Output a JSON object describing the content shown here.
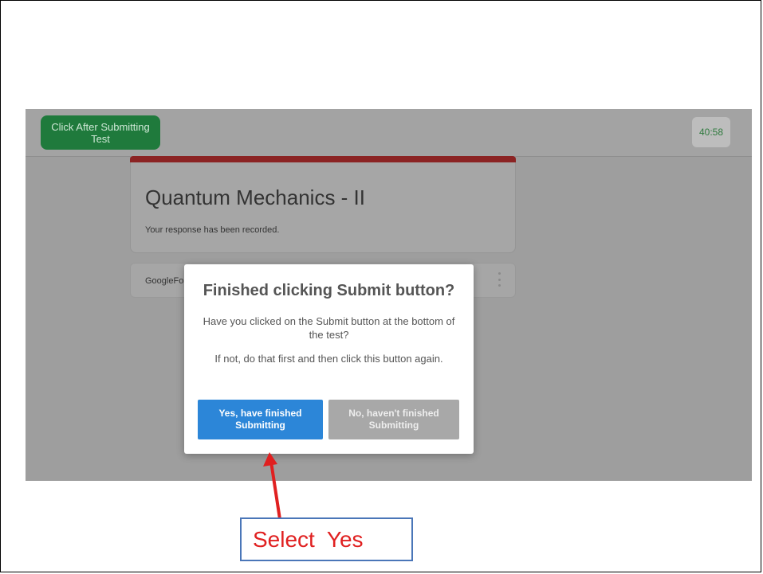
{
  "app": {
    "after_submit_label": "Click After Submitting Test",
    "timer": "40:58"
  },
  "form": {
    "title": "Quantum Mechanics - II",
    "status": "Your response has been recorded.",
    "footer_brand": "GoogleFor"
  },
  "dialog": {
    "title": "Finished clicking Submit button?",
    "question": "Have you clicked on the Submit button at the bottom of the test?",
    "instruction": "If not, do that first and then click this button again.",
    "yes_label": "Yes, have finished Submitting",
    "no_label": "No, haven't finished Submitting"
  },
  "annotation": {
    "callout": "Select  Yes",
    "arrow_color": "#e02020",
    "box_border_color": "#4a76b8"
  },
  "colors": {
    "accent_green": "#1f7a3c",
    "form_accent": "#8b2323",
    "yes_blue": "#2c86d8"
  }
}
